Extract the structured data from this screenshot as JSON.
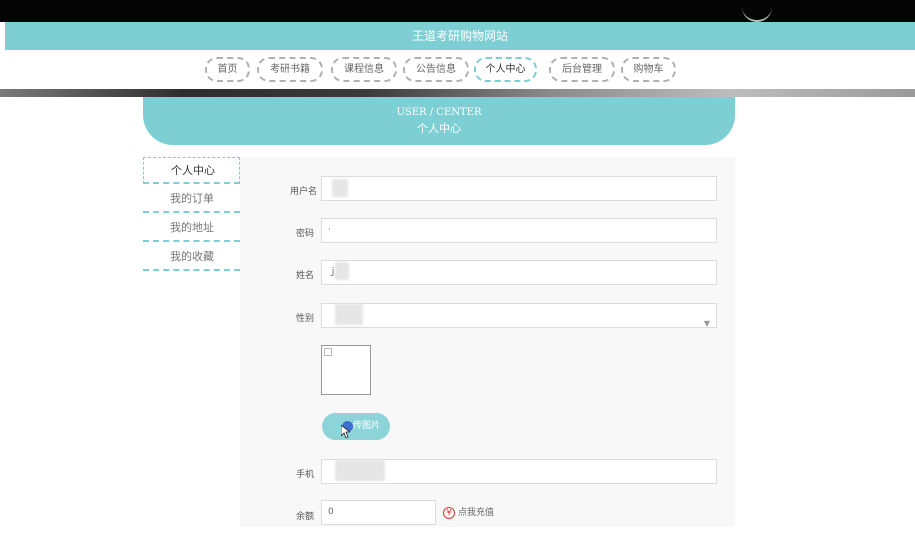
{
  "site_title": "王道考研购物网站",
  "nav": {
    "items": [
      {
        "label": "首页"
      },
      {
        "label": "考研书籍"
      },
      {
        "label": "课程信息"
      },
      {
        "label": "公告信息"
      },
      {
        "label": "个人中心"
      },
      {
        "label": "后台管理"
      },
      {
        "label": "购物车"
      }
    ],
    "active_index": 4
  },
  "header": {
    "en": "USER / CENTER",
    "cn": "个人中心"
  },
  "sidebar": {
    "items": [
      {
        "label": "个人中心"
      },
      {
        "label": "我的订单"
      },
      {
        "label": "我的地址"
      },
      {
        "label": "我的收藏"
      }
    ]
  },
  "form": {
    "username_label": "用户名",
    "password_label": "密码",
    "password_value": "·",
    "name_label": "姓名",
    "name_value": "ｊ",
    "gender_label": "性别",
    "upload_label": "上传图片",
    "phone_label": "手机",
    "balance_label": "余额",
    "balance_value": "0",
    "recharge_label": "点我充值"
  },
  "colors": {
    "accent": "#7ecfd4",
    "topbar": "#050505"
  }
}
